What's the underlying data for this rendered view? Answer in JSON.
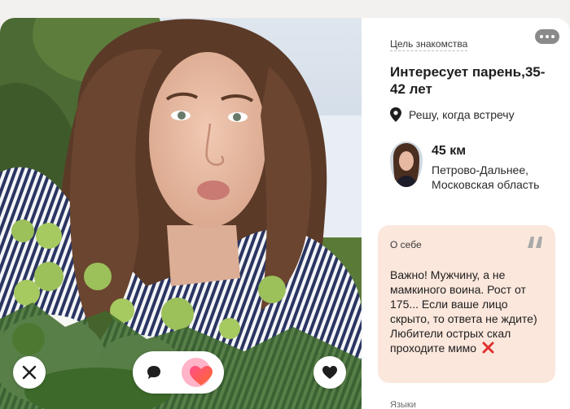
{
  "profile": {
    "goal_label": "Цель знакомства",
    "goal_title": "Интересует парень,35-42 лет",
    "decide_text": "Решу, когда встречу",
    "distance": "45 км",
    "location": "Петрово-Дальнее, Московская область",
    "about_label": "О себе",
    "about_text": "Важно! Мужчину, а не мамкиного воина. Рост от 175... Если ваше лицо скрыто, то ответа не ждите) Любители острых скал проходите мимо",
    "languages_label": "Языки"
  },
  "icons": {
    "more": "more-icon",
    "location": "location-pin-icon",
    "quote": "quote-icon",
    "cross_emoji": "red-cross-icon",
    "close": "close-icon",
    "message": "message-icon",
    "super_like": "super-like-icon",
    "like": "heart-icon"
  },
  "colors": {
    "about_bg": "#fbe7dc",
    "cross": "#e0312e",
    "super_like_orange": "#ff6a2a",
    "super_like_pink": "#ff4d8a"
  }
}
